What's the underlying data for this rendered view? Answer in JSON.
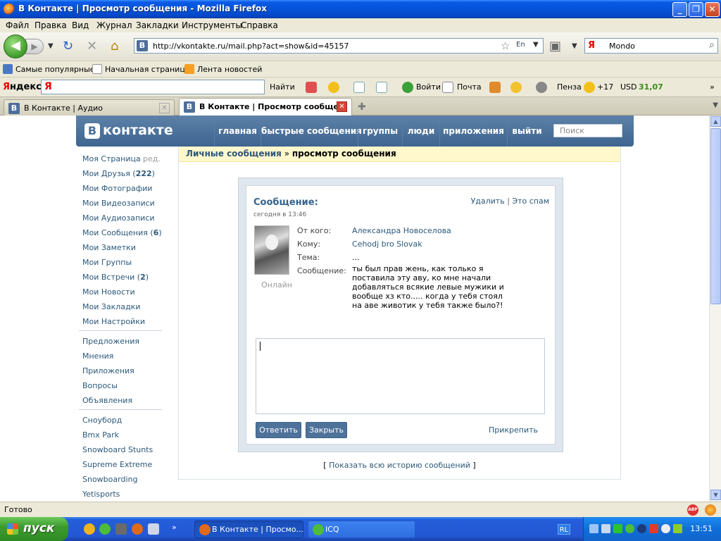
{
  "window": {
    "title": "В Контакте | Просмотр сообщения - Mozilla Firefox",
    "min": "_",
    "max": "❐",
    "close": "✕"
  },
  "menu": [
    "Файл",
    "Правка",
    "Вид",
    "Журнал",
    "Закладки",
    "Инструменты",
    "Справка"
  ],
  "nav": {
    "url": "http://vkontakte.ru/mail.php?act=show&id=45157",
    "lang_indicator": "En",
    "search_engine": "Я",
    "search_value": "Mondo"
  },
  "bookmarks": [
    "Самые популярные",
    "Начальная страница",
    "Лента новостей"
  ],
  "yandex_bar": {
    "logo_pre": "Я",
    "logo_post": "ндекс",
    "input_logo": "Я",
    "find": "Найти",
    "login": "Войти",
    "mail": "Почта",
    "city": "Пенза",
    "temp": "+17",
    "usd_label": "USD",
    "usd_value": "31,07",
    "more": "»"
  },
  "tabs": [
    {
      "label": "В Контакте | Аудио",
      "active": false
    },
    {
      "label": "В Контакте | Просмотр сообще...",
      "active": true
    }
  ],
  "vk": {
    "logo_mark": "В",
    "logo_text": "контакте",
    "nav": [
      "главная",
      "быстрые сообщения",
      "группы",
      "люди",
      "приложения",
      "выйти"
    ],
    "search_placeholder": "Поиск",
    "left_menu_main": [
      {
        "label": "Моя Страница",
        "count": ""
      },
      {
        "label": "Мои Друзья",
        "count": "222"
      },
      {
        "label": "Мои Фотографии",
        "count": ""
      },
      {
        "label": "Мои Видеозаписи",
        "count": ""
      },
      {
        "label": "Мои Аудиозаписи",
        "count": ""
      },
      {
        "label": "Мои Сообщения",
        "count": "6"
      },
      {
        "label": "Мои Заметки",
        "count": ""
      },
      {
        "label": "Мои Группы",
        "count": ""
      },
      {
        "label": "Мои Встречи",
        "count": "2"
      },
      {
        "label": "Мои Новости",
        "count": ""
      },
      {
        "label": "Мои Закладки",
        "count": ""
      },
      {
        "label": "Мои Настройки",
        "count": ""
      }
    ],
    "edit_label": "ред.",
    "left_menu_extra": [
      "Предложения",
      "Мнения",
      "Приложения",
      "Вопросы",
      "Объявления"
    ],
    "left_menu_apps": [
      "Сноуборд",
      "Bmx Park",
      "Snowboard Stunts",
      "Supreme Extreme",
      "Snowboarding",
      "Yetisports"
    ],
    "breadcrumb": {
      "link": "Личные сообщения",
      "sep": " » ",
      "current": "просмотр сообщения"
    },
    "message": {
      "title": "Сообщение:",
      "delete": "Удалить",
      "spam": "Это спам",
      "date": "сегодня в 13:46",
      "online": "Онлайн",
      "from_label": "От кого:",
      "from_value": "Александра Новоселова",
      "to_label": "Кому:",
      "to_value": "Cehodj bro Slovak",
      "subject_label": "Тема:",
      "subject_value": "...",
      "body_label": "Сообщение:",
      "body": "ты был прав жень, как только я поставила эту аву, ко мне начали добавляться всякие левые мужики и вообще хз кто..... когда у тебя стоял на аве животик у тебя также было?!",
      "reply_button": "Ответить",
      "close_button": "Закрыть",
      "attach": "Прикрепить"
    },
    "history": {
      "open": "[ ",
      "link": "Показать всю историю сообщений",
      "close": " ]"
    }
  },
  "status": "Готово",
  "abp": "ABP",
  "taskbar": {
    "start": "пуск",
    "tasks": [
      "В Контакте | Просмо...",
      "ICQ"
    ],
    "more": "»",
    "lang": "RL",
    "clock": "13:51"
  }
}
